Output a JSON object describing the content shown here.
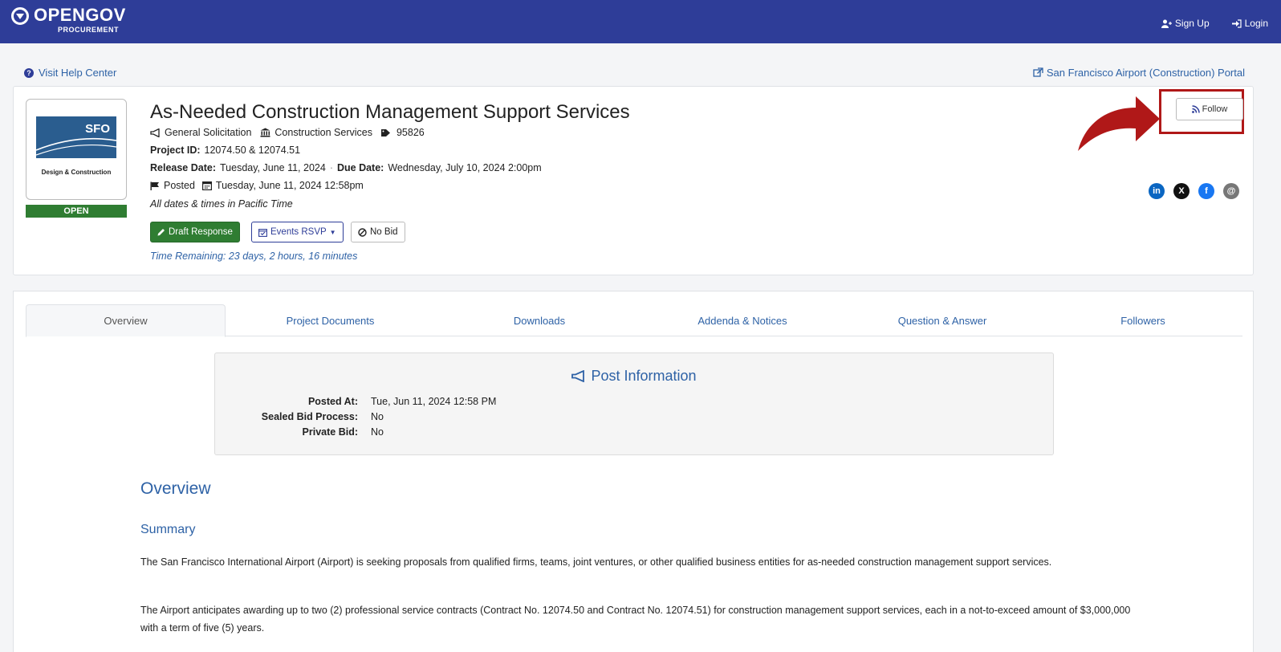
{
  "topbar": {
    "logo_text": "OPENGOV",
    "logo_sub": "PROCUREMENT",
    "signup_label": "Sign Up",
    "login_label": "Login"
  },
  "help_link": "Visit Help Center",
  "portal_link": "San Francisco Airport (Construction) Portal",
  "project": {
    "logo_text": "SFO",
    "logo_subtitle": "Design & Construction",
    "status": "OPEN",
    "title": "As-Needed Construction Management Support Services",
    "type": "General Solicitation",
    "category": "Construction Services",
    "tag": "95826",
    "project_id_label": "Project ID:",
    "project_id": "12074.50 & 12074.51",
    "release_label": "Release Date:",
    "release_date": "Tuesday, June 11, 2024",
    "separator": "·",
    "due_label": "Due Date:",
    "due_date": "Wednesday, July 10, 2024 2:00pm",
    "posted_label": "Posted",
    "posted_date": "Tuesday, June 11, 2024 12:58pm",
    "timezone_note": "All dates & times in Pacific Time",
    "time_remaining": "Time Remaining: 23 days, 2 hours, 16 minutes"
  },
  "actions": {
    "draft": "Draft Response",
    "events": "Events RSVP",
    "nobid": "No Bid",
    "follow": "Follow"
  },
  "social": [
    "in",
    "X",
    "f",
    "@"
  ],
  "tabs": [
    "Overview",
    "Project Documents",
    "Downloads",
    "Addenda & Notices",
    "Question & Answer",
    "Followers"
  ],
  "post_info": {
    "title": "Post Information",
    "rows": [
      {
        "label": "Posted At:",
        "value": "Tue, Jun 11, 2024 12:58 PM"
      },
      {
        "label": "Sealed Bid Process:",
        "value": "No"
      },
      {
        "label": "Private Bid:",
        "value": "No"
      }
    ]
  },
  "overview": {
    "heading": "Overview",
    "summary_heading": "Summary",
    "paragraphs": [
      "The San Francisco International Airport (Airport) is seeking proposals from qualified firms, teams, joint ventures, or other qualified business entities for as-needed construction management support services.",
      "The Airport anticipates awarding up to two (2) professional service contracts (Contract No. 12074.50 and Contract No. 12074.51) for construction management support services, each in a not-to-exceed amount of $3,000,000 with a term of five (5) years."
    ]
  },
  "colors": {
    "topbar": "#2e3d98",
    "link": "#2e62a6",
    "green": "#2f7d32",
    "highlight": "#b01818"
  }
}
